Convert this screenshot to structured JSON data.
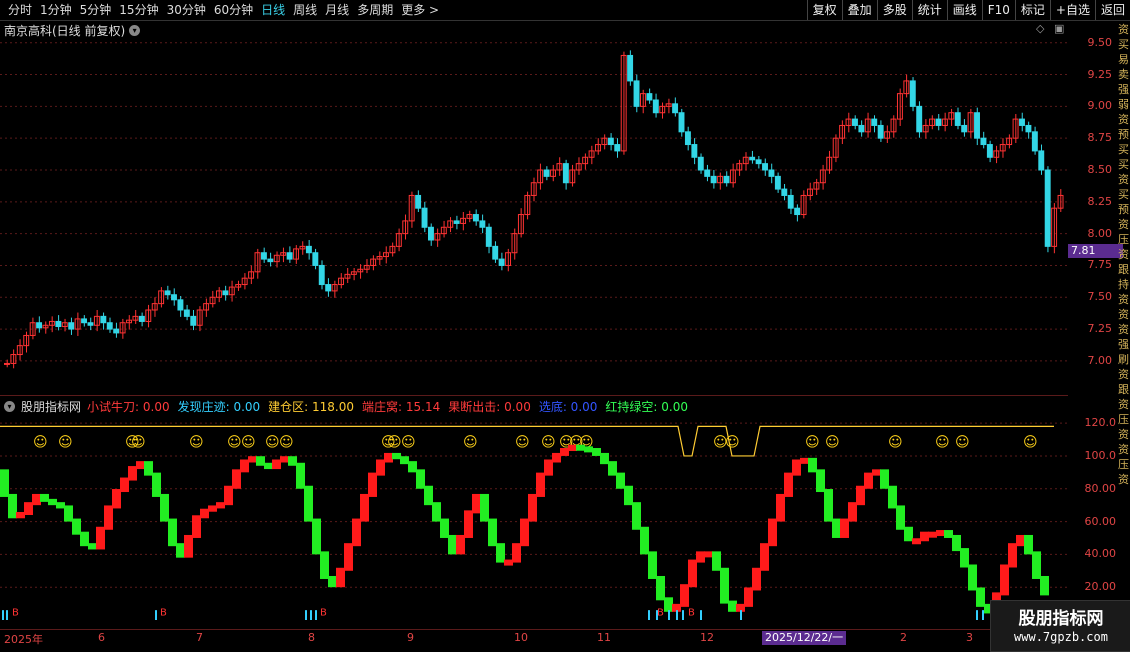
{
  "toolbar": {
    "periods": [
      "分时",
      "1分钟",
      "5分钟",
      "15分钟",
      "30分钟",
      "60分钟",
      "日线",
      "周线",
      "月线",
      "多周期",
      "更多 >"
    ],
    "active_period": "日线",
    "buttons": [
      "复权",
      "叠加",
      "多股",
      "统计",
      "画线",
      "F10",
      "标记",
      "+自选",
      "返回"
    ]
  },
  "title": "南京高科(日线 前复权)",
  "price_axis": [
    "9.50",
    "9.25",
    "9.00",
    "8.75",
    "8.50",
    "8.25",
    "8.00",
    "7.75",
    "7.50",
    "7.25",
    "7.00"
  ],
  "current_price": "7.81",
  "indicator": {
    "name": "股朋指标网",
    "items": [
      {
        "label": "小试牛刀: 0.00",
        "color": "#ff3b3b"
      },
      {
        "label": "发现庄迹: 0.00",
        "color": "#33d0ff"
      },
      {
        "label": "建仓区: 118.00",
        "color": "#ffcc33"
      },
      {
        "label": "端庄窝: 15.14",
        "color": "#ff3b3b"
      },
      {
        "label": "果断出击: 0.00",
        "color": "#ff3b3b"
      },
      {
        "label": "选底: 0.00",
        "color": "#3355ff"
      },
      {
        "label": "红持绿空: 0.00",
        "color": "#33ff55"
      }
    ],
    "axis": [
      "120.0",
      "100.0",
      "80.00",
      "60.00",
      "40.00",
      "20.00"
    ]
  },
  "x_axis": [
    "2025年",
    "6",
    "7",
    "8",
    "9",
    "10",
    "11",
    "12",
    "2025/12/22/一",
    "2",
    "3"
  ],
  "right_strip": "资买易卖强弱资预买买资买预资压资跟持资资资强刷资跟资压资资压资",
  "watermark": {
    "title": "股朋指标网",
    "url": "www.7gpzb.com"
  },
  "colors": {
    "up": "#ff3333",
    "down": "#33d6e6",
    "osc_up": "#ff1a1a",
    "osc_down": "#22ee22",
    "grid": "#5a1a1a"
  },
  "chart_data": {
    "type": "candlestick",
    "ylim": [
      6.85,
      9.6
    ],
    "closes": [
      6.98,
      7.05,
      7.12,
      7.2,
      7.3,
      7.26,
      7.28,
      7.31,
      7.27,
      7.3,
      7.25,
      7.33,
      7.3,
      7.28,
      7.35,
      7.3,
      7.25,
      7.22,
      7.3,
      7.32,
      7.35,
      7.31,
      7.4,
      7.45,
      7.55,
      7.52,
      7.48,
      7.4,
      7.35,
      7.28,
      7.4,
      7.45,
      7.5,
      7.55,
      7.52,
      7.58,
      7.6,
      7.65,
      7.7,
      7.85,
      7.8,
      7.78,
      7.83,
      7.85,
      7.8,
      7.88,
      7.9,
      7.85,
      7.75,
      7.6,
      7.55,
      7.6,
      7.65,
      7.68,
      7.7,
      7.72,
      7.75,
      7.8,
      7.82,
      7.85,
      7.9,
      8.0,
      8.1,
      8.3,
      8.2,
      8.05,
      7.95,
      8.0,
      8.05,
      8.1,
      8.08,
      8.12,
      8.15,
      8.1,
      8.05,
      7.9,
      7.8,
      7.75,
      7.85,
      8.0,
      8.15,
      8.3,
      8.4,
      8.5,
      8.45,
      8.5,
      8.55,
      8.4,
      8.5,
      8.55,
      8.6,
      8.65,
      8.7,
      8.75,
      8.7,
      8.65,
      9.4,
      9.2,
      9.0,
      9.1,
      9.05,
      8.95,
      9.0,
      9.02,
      8.95,
      8.8,
      8.7,
      8.6,
      8.5,
      8.45,
      8.4,
      8.45,
      8.4,
      8.5,
      8.55,
      8.6,
      8.58,
      8.55,
      8.5,
      8.45,
      8.35,
      8.3,
      8.2,
      8.15,
      8.3,
      8.35,
      8.4,
      8.5,
      8.6,
      8.75,
      8.85,
      8.9,
      8.85,
      8.8,
      8.9,
      8.85,
      8.75,
      8.8,
      8.9,
      9.1,
      9.2,
      9.0,
      8.8,
      8.85,
      8.9,
      8.85,
      8.9,
      8.95,
      8.85,
      8.8,
      8.95,
      8.75,
      8.7,
      8.6,
      8.65,
      8.7,
      8.75,
      8.9,
      8.85,
      8.8,
      8.65,
      8.5,
      7.9,
      8.2,
      8.3
    ],
    "osc": [
      90,
      75,
      62,
      64,
      70,
      75,
      72,
      70,
      68,
      60,
      52,
      45,
      43,
      55,
      68,
      78,
      85,
      92,
      95,
      88,
      75,
      60,
      45,
      38,
      50,
      62,
      66,
      68,
      70,
      80,
      90,
      96,
      98,
      94,
      92,
      96,
      98,
      94,
      80,
      60,
      40,
      25,
      20,
      30,
      45,
      60,
      75,
      88,
      96,
      100,
      98,
      95,
      90,
      80,
      70,
      60,
      50,
      40,
      50,
      65,
      75,
      60,
      45,
      35,
      35,
      45,
      60,
      75,
      88,
      96,
      100,
      103,
      105,
      104,
      103,
      100,
      95,
      88,
      80,
      70,
      55,
      40,
      25,
      12,
      5,
      8,
      20,
      35,
      40,
      40,
      30,
      10,
      5,
      8,
      18,
      30,
      45,
      60,
      75,
      88,
      96,
      97,
      90,
      78,
      60,
      50,
      60,
      70,
      80,
      88,
      90,
      80,
      68,
      55,
      48,
      48,
      52,
      52,
      53,
      50,
      42,
      32,
      18,
      8,
      4,
      15,
      32,
      45,
      50,
      40,
      25,
      15
    ]
  }
}
